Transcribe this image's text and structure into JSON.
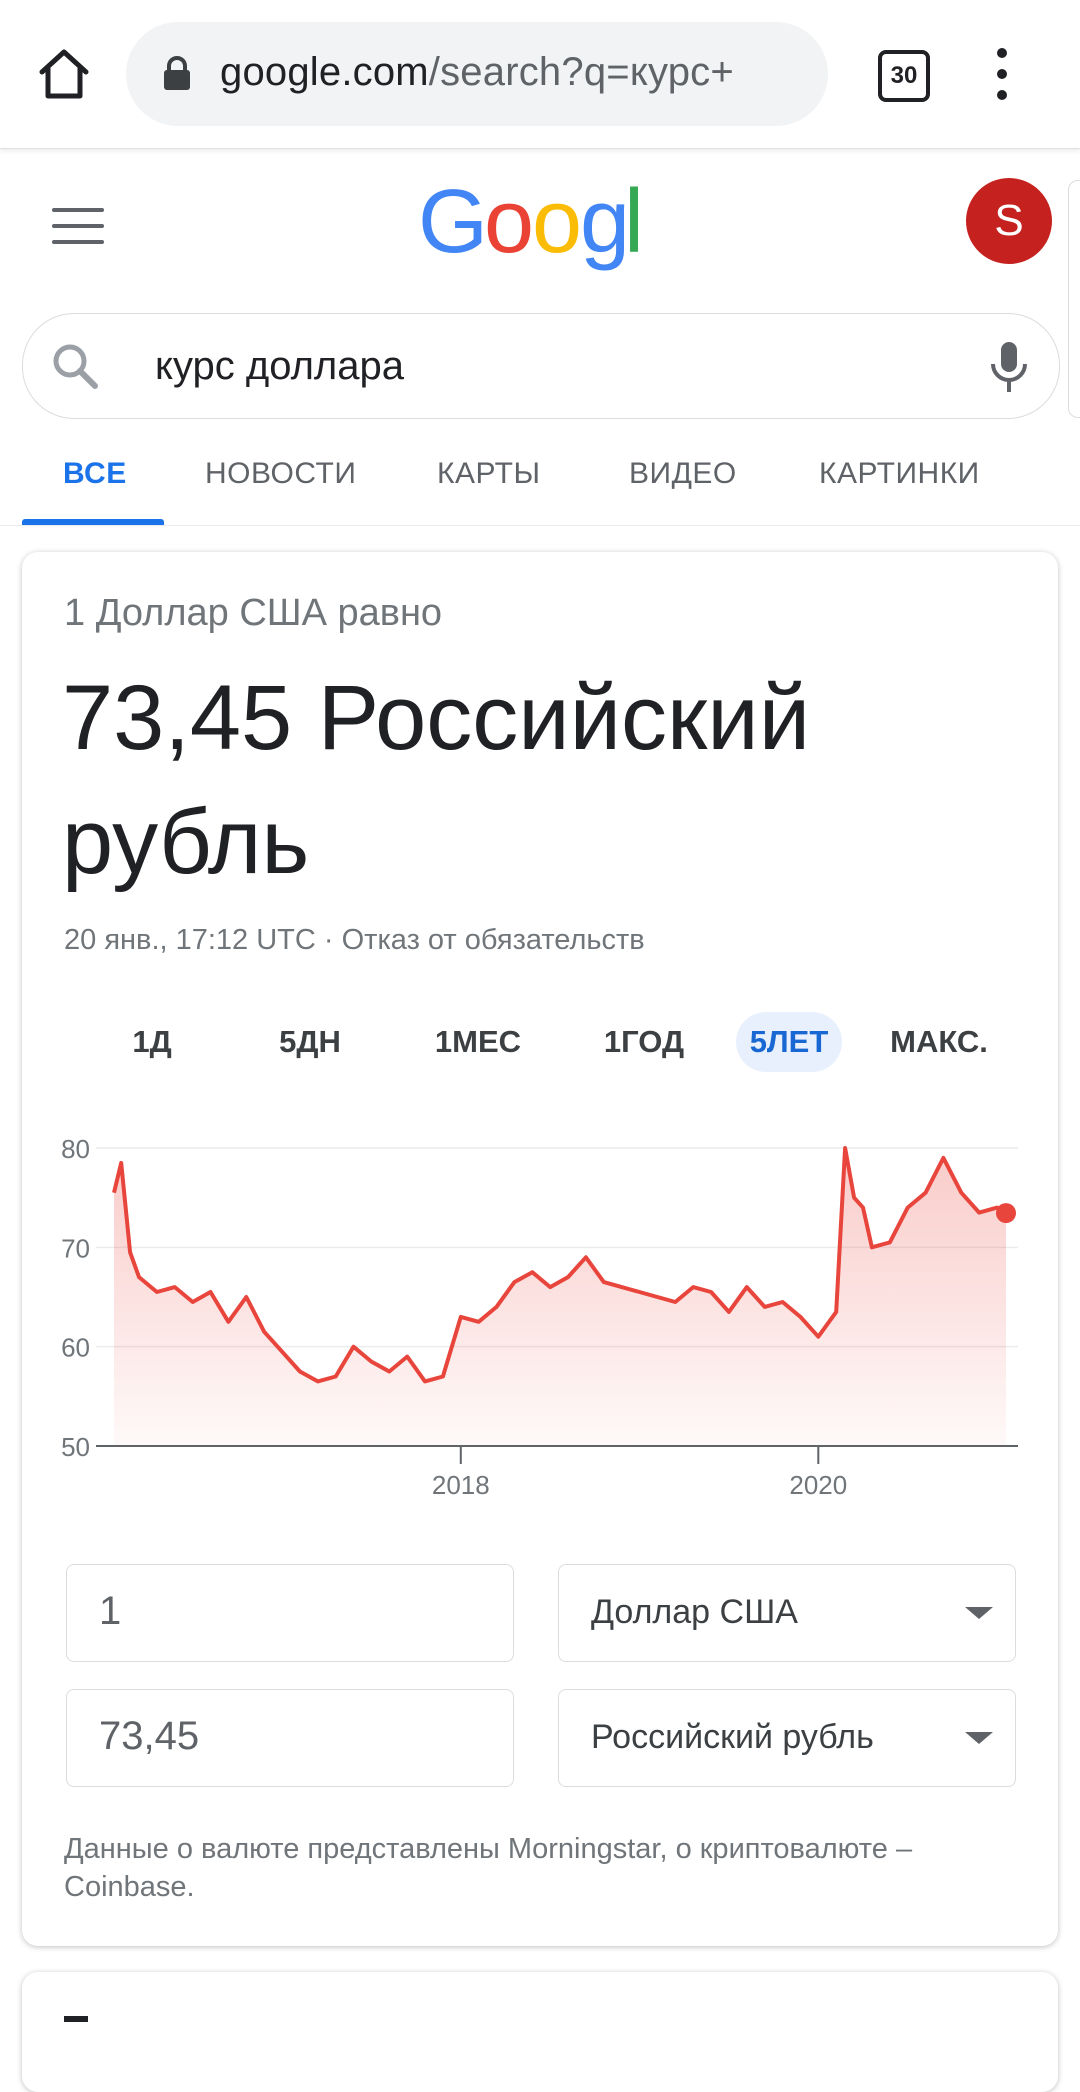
{
  "browser": {
    "url_host": "google.com",
    "url_path": "/search?q=курс+",
    "tab_count": "30"
  },
  "google": {
    "avatar_letter": "S",
    "search_query": "курс доллара"
  },
  "tabs": [
    {
      "label": "ВСЕ",
      "active": true
    },
    {
      "label": "НОВОСТИ"
    },
    {
      "label": "КАРТЫ"
    },
    {
      "label": "ВИДЕО"
    },
    {
      "label": "КАРТИНКИ"
    }
  ],
  "card": {
    "equals_label": "1 Доллар США равно",
    "result_value": "73,45 Российский рубль",
    "timestamp": "20 янв., 17:12 UTC · Отказ от обязательств",
    "range_tabs": [
      "1Д",
      "5ДН",
      "1МЕС",
      "1ГОД",
      "5ЛЕТ",
      "МАКС."
    ],
    "active_range": "5ЛЕТ",
    "converter": {
      "amount_from": "1",
      "currency_from": "Доллар США",
      "amount_to": "73,45",
      "currency_to": "Российский рубль"
    },
    "disclaimer": "Данные о валюте представлены Morningstar, о криптовалюте – Coinbase."
  },
  "colors": {
    "line": "#e8453c",
    "accent": "#1a73e8"
  },
  "chart_data": {
    "type": "area",
    "ylim": [
      50,
      80
    ],
    "xlim": [
      2016.06,
      2021.05
    ],
    "yticks": [
      50,
      60,
      70,
      80
    ],
    "xticks": [
      "2018",
      "2020"
    ],
    "grid": true,
    "series": [
      {
        "x": [
          2016.06,
          2016.1,
          2016.15,
          2016.2,
          2016.3,
          2016.4,
          2016.5,
          2016.6,
          2016.7,
          2016.8,
          2016.9,
          2017.0,
          2017.1,
          2017.2,
          2017.3,
          2017.4,
          2017.5,
          2017.6,
          2017.7,
          2017.8,
          2017.9,
          2018.0,
          2018.1,
          2018.2,
          2018.3,
          2018.4,
          2018.5,
          2018.6,
          2018.7,
          2018.8,
          2018.9,
          2019.0,
          2019.1,
          2019.2,
          2019.3,
          2019.4,
          2019.5,
          2019.6,
          2019.7,
          2019.8,
          2019.9,
          2020.0,
          2020.1,
          2020.15,
          2020.2,
          2020.25,
          2020.3,
          2020.4,
          2020.5,
          2020.6,
          2020.7,
          2020.8,
          2020.9,
          2021.0,
          2021.05
        ],
        "values": [
          75.5,
          78.5,
          69.5,
          67,
          65.5,
          66,
          64.5,
          65.5,
          62.5,
          65,
          61.5,
          59.5,
          57.5,
          56.5,
          57,
          60,
          58.5,
          57.5,
          59,
          56.5,
          57,
          63,
          62.5,
          64,
          66.5,
          67.5,
          66,
          67,
          69,
          66.5,
          66,
          65.5,
          65,
          64.5,
          66,
          65.5,
          63.5,
          66,
          64,
          64.5,
          63,
          61,
          63.5,
          80,
          75,
          74,
          70,
          70.5,
          74,
          75.5,
          79,
          75.5,
          73.5,
          74,
          73.45
        ]
      }
    ]
  }
}
